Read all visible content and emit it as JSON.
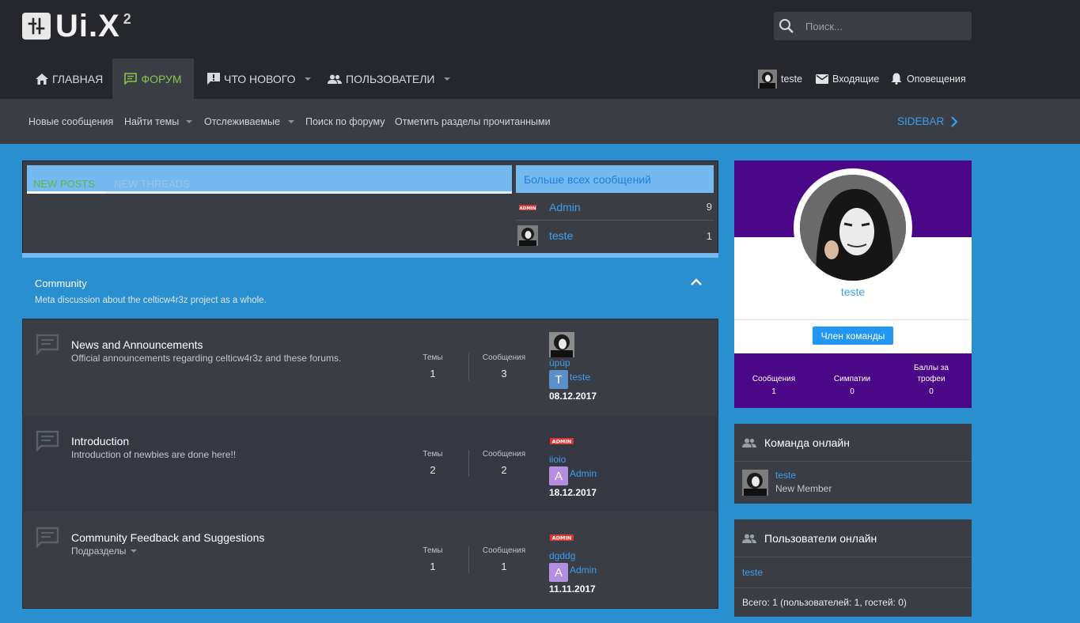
{
  "logo": {
    "text": "Ui.X",
    "sup": "2"
  },
  "search": {
    "placeholder": "Поиск..."
  },
  "nav": {
    "home": "ГЛАВНАЯ",
    "forum": "ФОРУМ",
    "whats_new": "ЧТО НОВОГО",
    "members": "ПОЛЬЗОВАТЕЛИ"
  },
  "user_nav": {
    "username": "teste",
    "inbox": "Входящие",
    "alerts": "Оповещения"
  },
  "subnav": {
    "new_posts": "Новые сообщения",
    "find_threads": "Найти темы",
    "watched": "Отслеживаемые",
    "search_forums": "Поиск по форуму",
    "mark_read": "Отметить разделы прочитанными",
    "sidebar": "SIDEBAR"
  },
  "widget": {
    "tab_new_posts": "NEW POSTS",
    "tab_new_threads": "NEW THREADS",
    "top_title": "Больше всех сообщений",
    "top_posters": [
      {
        "name": "Admin",
        "count": "9"
      },
      {
        "name": "teste",
        "count": "1"
      }
    ]
  },
  "category": {
    "title": "Community",
    "description": "Meta discussion about the celticw4r3z project as a whole."
  },
  "stat_labels": {
    "threads": "Темы",
    "messages": "Сообщения"
  },
  "forums": [
    {
      "title": "News and Announcements",
      "description": "Official announcements regarding celticw4r3z and these forums.",
      "threads": "1",
      "messages": "3",
      "last_title": "ùpùp",
      "last_user_letter": "T",
      "last_user": "teste",
      "last_date": "08.12.2017",
      "letter_color": "#5b8fc7"
    },
    {
      "title": "Introduction",
      "description": "Introduction of newbies are done here!!",
      "threads": "2",
      "messages": "2",
      "last_title": "iioio",
      "last_user_letter": "A",
      "last_user": "Admin",
      "last_date": "18.12.2017",
      "letter_color": "#b48ee0"
    },
    {
      "title": "Community Feedback and Suggestions",
      "description": "Подразделы",
      "threads": "1",
      "messages": "1",
      "last_title": "dgddg",
      "last_user_letter": "A",
      "last_user": "Admin",
      "last_date": "11.11.2017",
      "letter_color": "#b48ee0"
    }
  ],
  "profile": {
    "name": "teste",
    "badge": "Член команды",
    "stats": [
      {
        "label": "Сообщения",
        "value": "1"
      },
      {
        "label": "Симпатии",
        "value": "0"
      },
      {
        "label": "Баллы за трофеи",
        "value": "0"
      }
    ]
  },
  "staff_online": {
    "title": "Команда онлайн",
    "member_name": "teste",
    "member_title": "New Member"
  },
  "members_online": {
    "title": "Пользователи онлайн",
    "member_name": "teste",
    "total": "Всего: 1 (пользователей: 1, гостей: 0)"
  },
  "colors": {
    "header": "#25272c",
    "panel": "#3a3d44",
    "accent": "#3a9ff0",
    "forum_active": "#8bc34a",
    "profile_purple": "#4a0888",
    "page_bg": "#2a8fcf"
  }
}
